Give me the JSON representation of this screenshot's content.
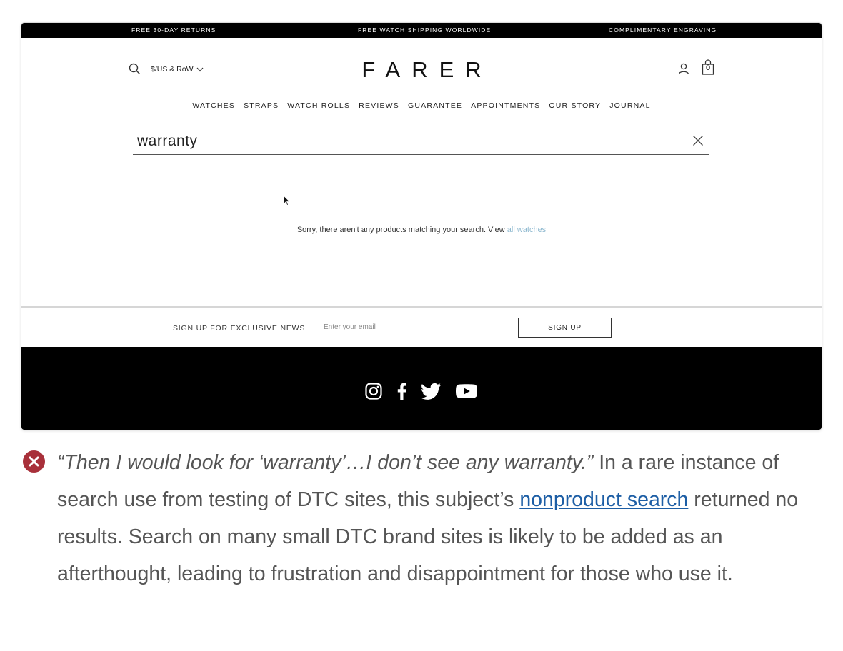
{
  "announcement_bar": {
    "left": "FREE 30-DAY RETURNS",
    "center": "FREE WATCH SHIPPING WORLDWIDE",
    "right": "COMPLIMENTARY ENGRAVING"
  },
  "header": {
    "currency_label": "$/US & RoW",
    "logo_text": "FARER",
    "cart_count": "0"
  },
  "nav": {
    "items": [
      "WATCHES",
      "STRAPS",
      "WATCH ROLLS",
      "REVIEWS",
      "GUARANTEE",
      "APPOINTMENTS",
      "OUR STORY",
      "JOURNAL"
    ]
  },
  "search": {
    "query": "warranty"
  },
  "results": {
    "empty_message": "Sorry, there aren't any products matching your search. View ",
    "link_text": "all watches"
  },
  "newsletter": {
    "label": "SIGN UP FOR EXCLUSIVE NEWS",
    "email_placeholder": "Enter your email",
    "button_label": "SIGN UP"
  },
  "footer": {
    "social_icons": [
      "instagram-icon",
      "facebook-icon",
      "twitter-icon",
      "youtube-icon"
    ]
  },
  "caption": {
    "quote": "“Then I would look for ‘warranty’…I don’t see any warranty.”",
    "text_before_link": " In a rare instance of search use from testing of DTC sites, this subject’s ",
    "link_text": "nonproduct search",
    "text_after_link": " returned no results. Search on many small DTC brand sites is likely to be added as an afterthought, leading to frustration and disappointment for those who use it."
  },
  "colors": {
    "error_icon": "#a8303a",
    "link": "#1d5ea5",
    "muted_link": "#8db8cf",
    "footer_bg": "#000000"
  }
}
